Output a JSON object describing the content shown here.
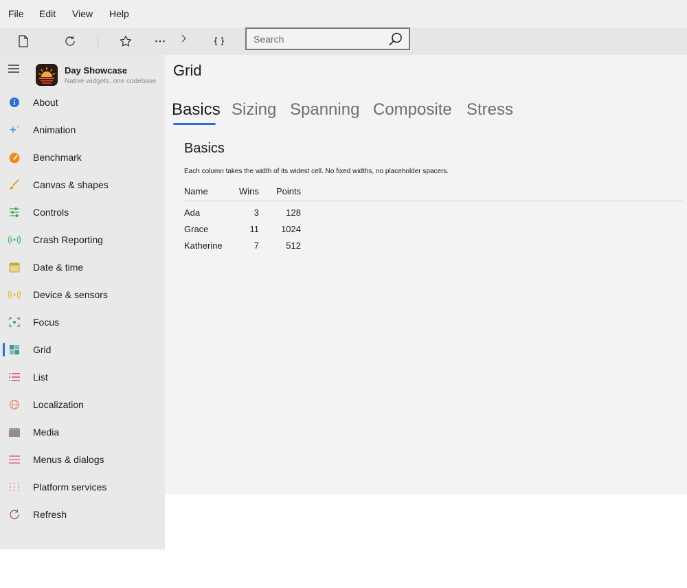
{
  "menu": {
    "items": [
      "File",
      "Edit",
      "View",
      "Help"
    ]
  },
  "toolbar": {
    "icons": [
      "new-file-icon",
      "refresh-icon",
      "star-icon",
      "more-icon",
      "chevron-right-icon",
      "bracket-icon"
    ],
    "search": {
      "placeholder": "Search",
      "value": ""
    }
  },
  "app": {
    "title": "Day Showcase",
    "subtitle": "Native widgets, one codebase"
  },
  "sidebar": {
    "items": [
      {
        "label": "About",
        "icon": "info-icon",
        "color": "#2a6fd6"
      },
      {
        "label": "Animation",
        "icon": "sparkle-icon",
        "color": "#5aa6e8"
      },
      {
        "label": "Benchmark",
        "icon": "gauge-icon",
        "color": "#f08a1c"
      },
      {
        "label": "Canvas & shapes",
        "icon": "brush-icon",
        "color": "#e8a03c"
      },
      {
        "label": "Controls",
        "icon": "sliders-icon",
        "color": "#3fa35a"
      },
      {
        "label": "Crash Reporting",
        "icon": "broadcast-icon",
        "color": "#48b85a"
      },
      {
        "label": "Date & time",
        "icon": "calendar-icon",
        "color": "#c9a93a"
      },
      {
        "label": "Device & sensors",
        "icon": "sensor-icon",
        "color": "#e0b830"
      },
      {
        "label": "Focus",
        "icon": "focus-icon",
        "color": "#3a9a8a"
      },
      {
        "label": "Grid",
        "icon": "grid-icon",
        "color": "#3a9a9a",
        "selected": true
      },
      {
        "label": "List",
        "icon": "list-icon",
        "color": "#e04a5a"
      },
      {
        "label": "Localization",
        "icon": "globe-icon",
        "color": "#ec8a7a"
      },
      {
        "label": "Media",
        "icon": "clapper-icon",
        "color": "#9a8a8a"
      },
      {
        "label": "Menus & dialogs",
        "icon": "menu-lines-icon",
        "color": "#e06a7a"
      },
      {
        "label": "Platform services",
        "icon": "dots-grid-icon",
        "color": "#e8a0b8"
      },
      {
        "label": "Refresh",
        "icon": "refresh-nav-icon",
        "color": "#a04a9a"
      }
    ]
  },
  "main": {
    "title": "Grid",
    "tabs": [
      {
        "label": "Basics",
        "active": true
      },
      {
        "label": "Sizing"
      },
      {
        "label": "Spanning"
      },
      {
        "label": "Composite"
      },
      {
        "label": "Stress"
      }
    ],
    "section": {
      "title": "Basics",
      "description": "Each column takes the width of its widest cell. No fixed widths, no placeholder spacers."
    },
    "grid": {
      "columns": [
        "Name",
        "Wins",
        "Points"
      ],
      "rows": [
        [
          "Ada",
          "3",
          "128"
        ],
        [
          "Grace",
          "11",
          "1024"
        ],
        [
          "Katherine",
          "7",
          "512"
        ]
      ]
    }
  },
  "colors": {
    "accent": "#2a6fd6"
  }
}
